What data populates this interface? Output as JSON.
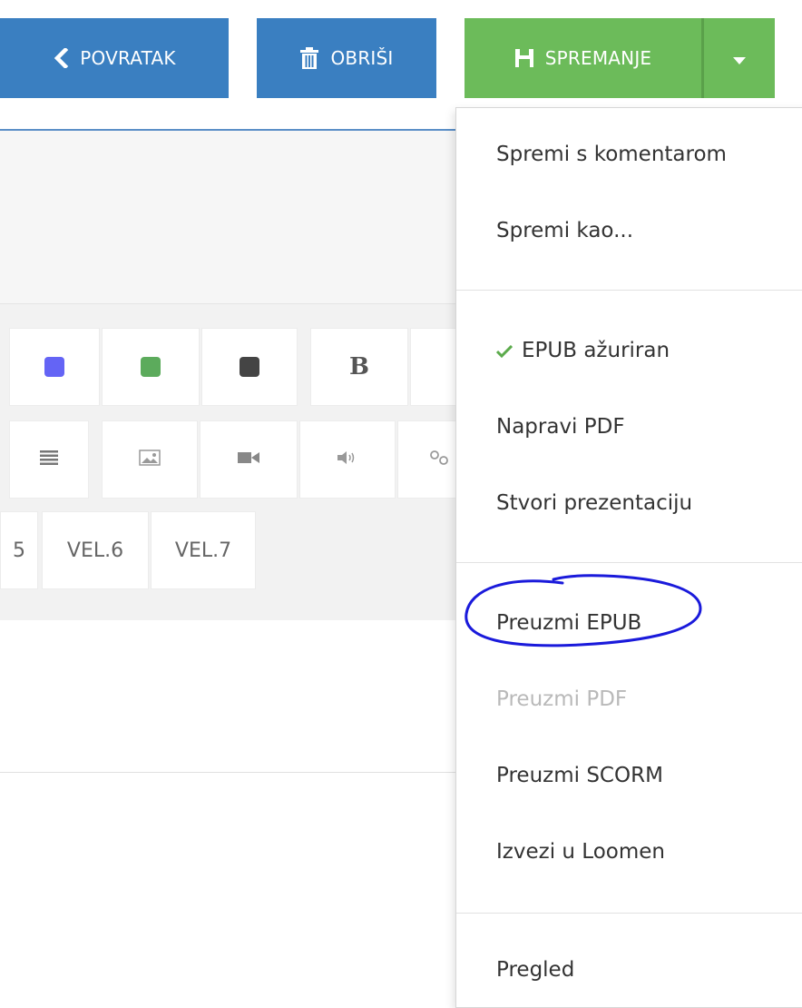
{
  "toolbar": {
    "back_label": "POVRATAK",
    "delete_label": "OBRIŠI",
    "save_label": "SPREMANJE"
  },
  "colors": {
    "primary": "#3a7fc1",
    "success": "#6cbb5a",
    "annotation": "#1a1adb"
  },
  "editor_toolbar": {
    "swatches": [
      "#6464f5",
      "#5cab5c",
      "#444444"
    ],
    "bold_label": "B",
    "size_partial": "5",
    "size_6": "VEL.6",
    "size_7": "VEL.7",
    "icons": [
      "align-justify-icon",
      "image-icon",
      "video-icon",
      "audio-icon",
      "link-icon"
    ]
  },
  "menu": {
    "items": [
      {
        "label": "Spremi s komentarom"
      },
      {
        "label": "Spremi kao..."
      },
      {
        "label": "EPUB ažuriran",
        "checked": true
      },
      {
        "label": "Napravi PDF"
      },
      {
        "label": "Stvori prezentaciju"
      },
      {
        "label": "Preuzmi EPUB",
        "highlighted": true
      },
      {
        "label": "Preuzmi PDF",
        "disabled": true
      },
      {
        "label": "Preuzmi SCORM"
      },
      {
        "label": "Izvezi u Loomen"
      },
      {
        "label": "Pregled"
      }
    ]
  }
}
